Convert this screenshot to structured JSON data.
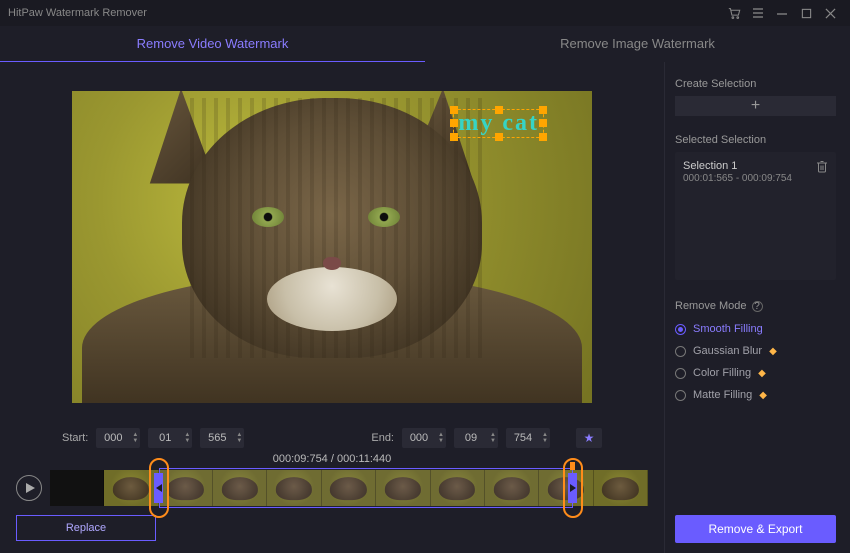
{
  "app": {
    "title": "HitPaw Watermark Remover"
  },
  "tabs": {
    "video": "Remove Video Watermark",
    "image": "Remove Image Watermark"
  },
  "preview": {
    "watermark_text": "my cat"
  },
  "time": {
    "start_label": "Start:",
    "end_label": "End:",
    "start_h": "000",
    "start_m": "01",
    "start_s": "565",
    "end_h": "000",
    "end_m": "09",
    "end_s": "754",
    "counter_current": "000:09:754",
    "counter_total": "000:11:440",
    "counter_sep": " / "
  },
  "sidebar": {
    "create_label": "Create Selection",
    "selected_label": "Selected Selection",
    "selection": {
      "name": "Selection 1",
      "range": "000:01:565 - 000:09:754"
    },
    "mode_label": "Remove Mode",
    "modes": {
      "smooth": "Smooth Filling",
      "gaussian": "Gaussian Blur",
      "color": "Color Filling",
      "matte": "Matte Filling"
    }
  },
  "buttons": {
    "replace": "Replace",
    "export": "Remove & Export"
  }
}
